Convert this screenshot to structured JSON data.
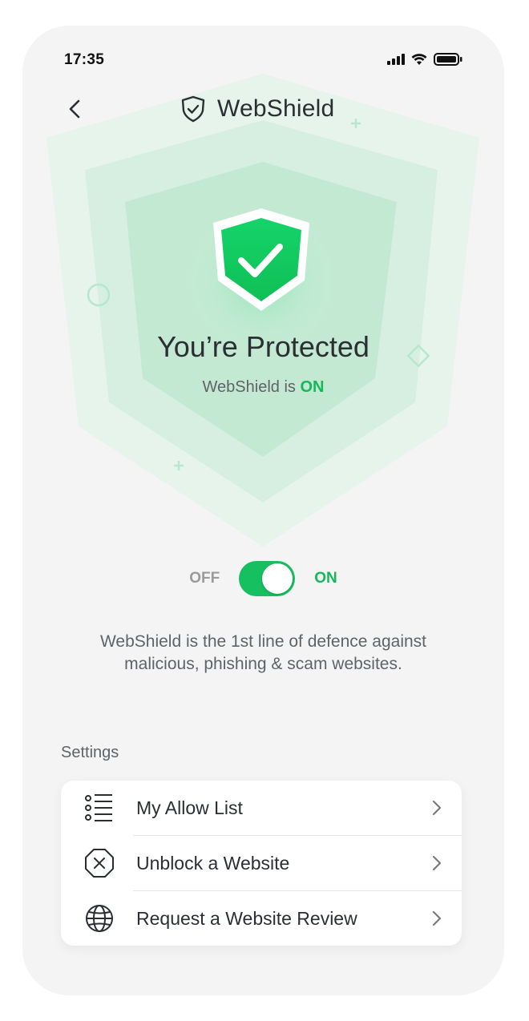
{
  "status_bar": {
    "time": "17:35"
  },
  "header": {
    "title": "WebShield"
  },
  "hero": {
    "title": "You’re Protected",
    "status_prefix": "WebShield is",
    "status_value": "ON"
  },
  "toggle": {
    "off_label": "OFF",
    "on_label": "ON",
    "state": "on"
  },
  "description": "WebShield is the 1st line of defence against malicious, phishing & scam websites.",
  "settings": {
    "heading": "Settings",
    "items": [
      {
        "label": "My Allow List",
        "icon": "list-icon"
      },
      {
        "label": "Unblock a Website",
        "icon": "octagon-x-icon"
      },
      {
        "label": "Request a Website Review",
        "icon": "globe-icon"
      }
    ]
  },
  "colors": {
    "accent": "#16c060",
    "accent_text": "#16b85a",
    "background": "#f4f4f4"
  }
}
